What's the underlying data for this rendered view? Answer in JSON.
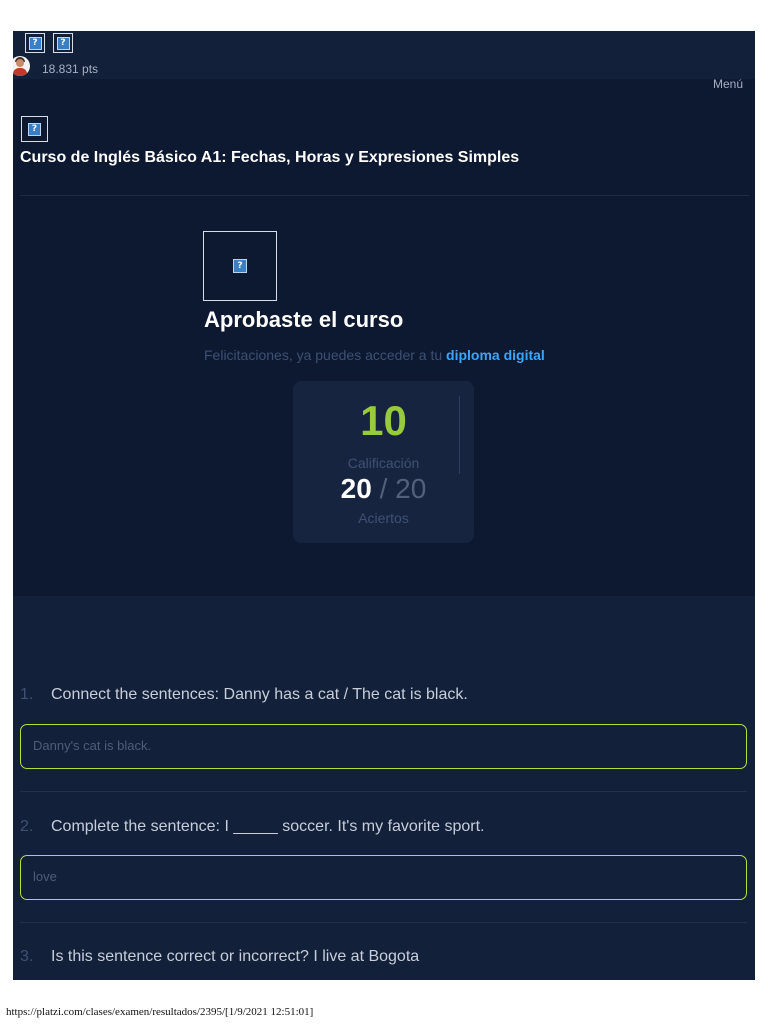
{
  "topbar": {
    "points": "18.831 pts",
    "menu_label": "Menú"
  },
  "course": {
    "title": "Curso de Inglés Básico A1: Fechas, Horas y Expresiones Simples"
  },
  "result": {
    "heading": "Aprobaste el curso",
    "congrats_text": "Felicitaciones, ya puedes acceder a tu",
    "diploma_link": "diploma digital",
    "grade": "10",
    "grade_label": "Calificación",
    "hits": "20",
    "hits_separator": "/",
    "hits_total": "20",
    "hits_label": "Aciertos"
  },
  "questions": [
    {
      "number": "1.",
      "text": "Connect the sentences: Danny has a cat / The cat is black.",
      "answer": "Danny's cat is black."
    },
    {
      "number": "2.",
      "text": "Complete the sentence: I _____ soccer. It's my favorite sport.",
      "answer": "love"
    },
    {
      "number": "3.",
      "text": "Is this sentence correct or incorrect? I live at Bogota",
      "answer": ""
    }
  ],
  "footer": {
    "url": "https://platzi.com/clases/examen/resultados/2395/[1/9/2021 12:51:01]"
  },
  "colors": {
    "accent_green": "#98cb3c",
    "link_blue": "#3aa6ff",
    "answer_border": "#b6de3a",
    "background": "#0d1831"
  }
}
